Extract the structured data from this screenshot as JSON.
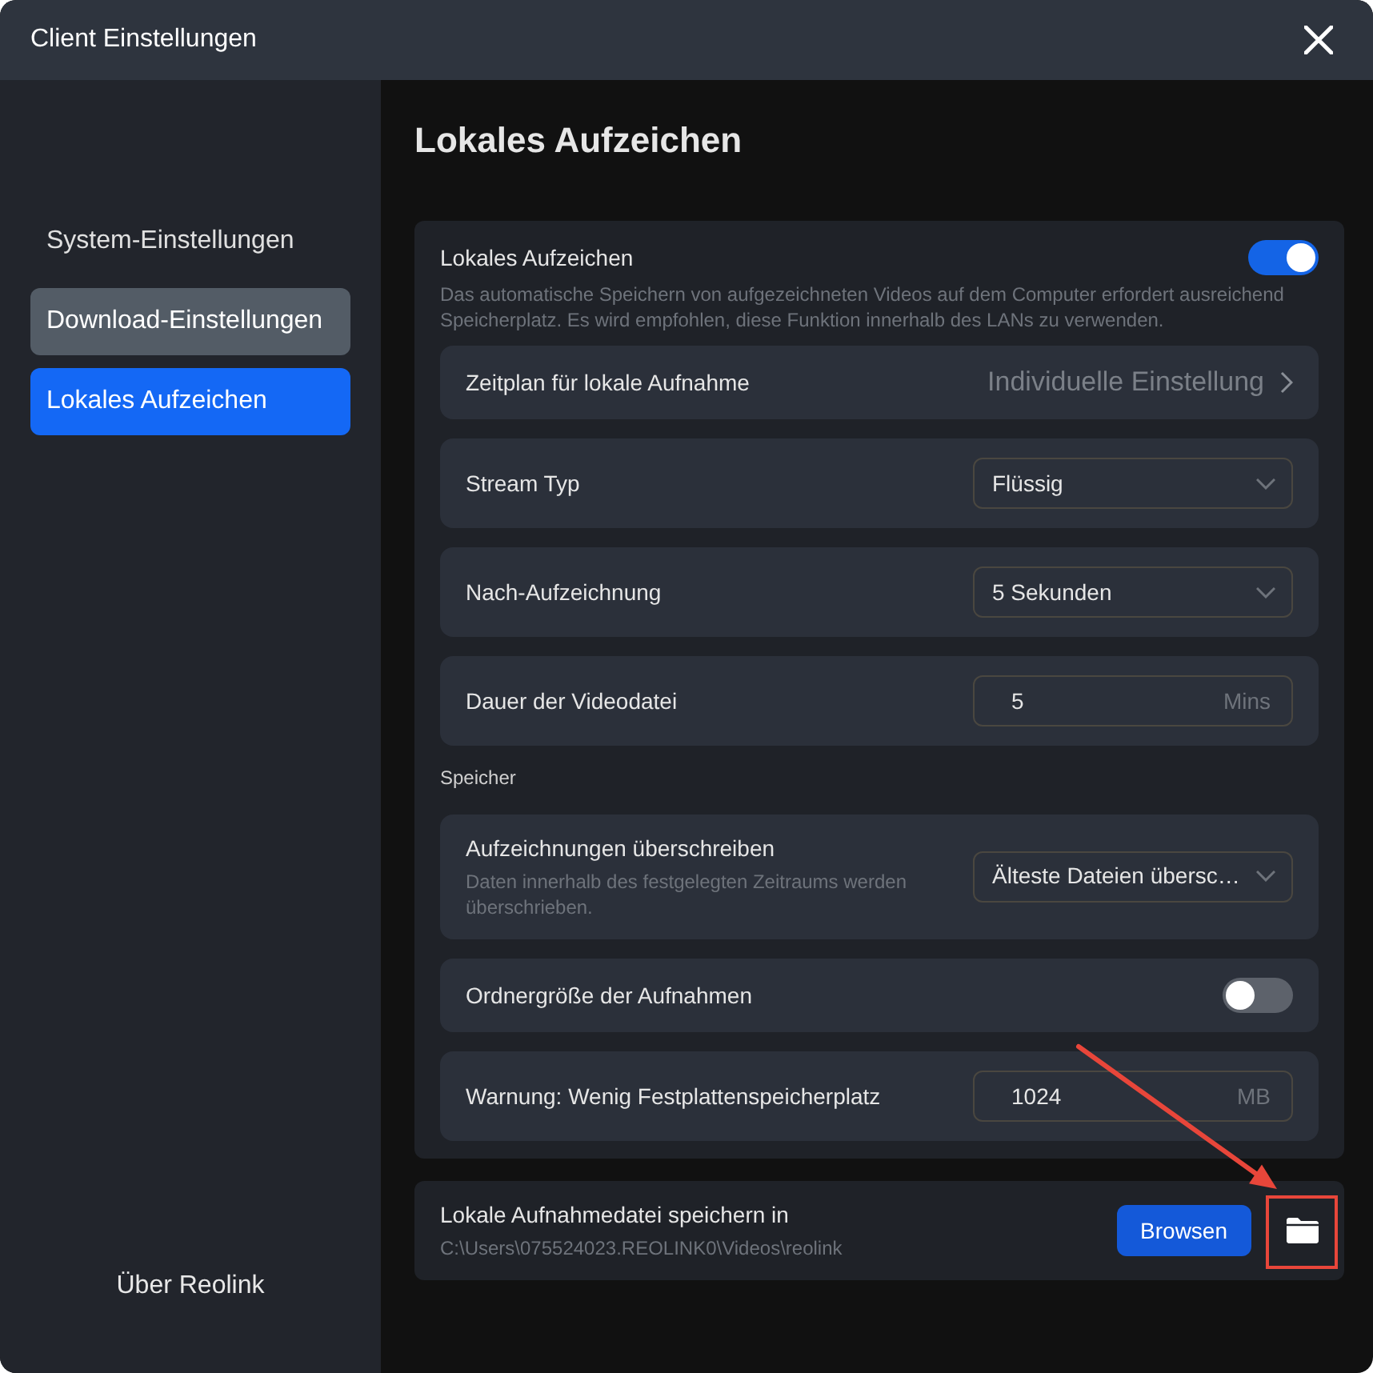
{
  "window": {
    "title": "Client Einstellungen"
  },
  "sidebar": {
    "items": [
      {
        "label": "System-Einstellungen",
        "selected": false,
        "hovered": false
      },
      {
        "label": "Download-Einstellungen",
        "selected": false,
        "hovered": true
      },
      {
        "label": "Lokales Aufzeichen",
        "selected": true,
        "hovered": false
      }
    ],
    "footer": "Über Reolink"
  },
  "page": {
    "title": "Lokales Aufzeichen"
  },
  "main_section": {
    "title": "Lokales Aufzeichen",
    "on": true,
    "description": "Das automatische Speichern von aufgezeichneten Videos auf dem Computer erfordert ausreichend Speicherplatz. Es wird empfohlen, diese Funktion innerhalb des LANs zu verwenden.",
    "rows": [
      {
        "kind": "link",
        "label": "Zeitplan für lokale Aufnahme",
        "value": "Individuelle Einstellung"
      },
      {
        "kind": "select",
        "label": "Stream Typ",
        "value": "Flüssig"
      },
      {
        "kind": "select",
        "label": "Nach-Aufzeichnung",
        "value": "5 Sekunden"
      },
      {
        "kind": "number",
        "label": "Dauer der Videodatei",
        "value": "5",
        "unit": "Mins"
      },
      {
        "kind": "section",
        "label": "Speicher"
      },
      {
        "kind": "select",
        "label": "Aufzeichnungen überschreiben",
        "hint": "Daten innerhalb des festgelegten Zeitraums werden überschrieben.",
        "value": "Älteste Dateien übersc…"
      },
      {
        "kind": "toggle",
        "label": "Ordnergröße der Aufnahmen",
        "on": false
      },
      {
        "kind": "number",
        "label": "Warnung: Wenig Festplattenspeicherplatz",
        "value": "1024",
        "unit": "MB"
      }
    ]
  },
  "save_location": {
    "label": "Lokale Aufnahmedatei speichern in",
    "path": "C:\\Users\\075524023.REOLINK0\\Videos\\reolink",
    "button": "Browsen"
  }
}
